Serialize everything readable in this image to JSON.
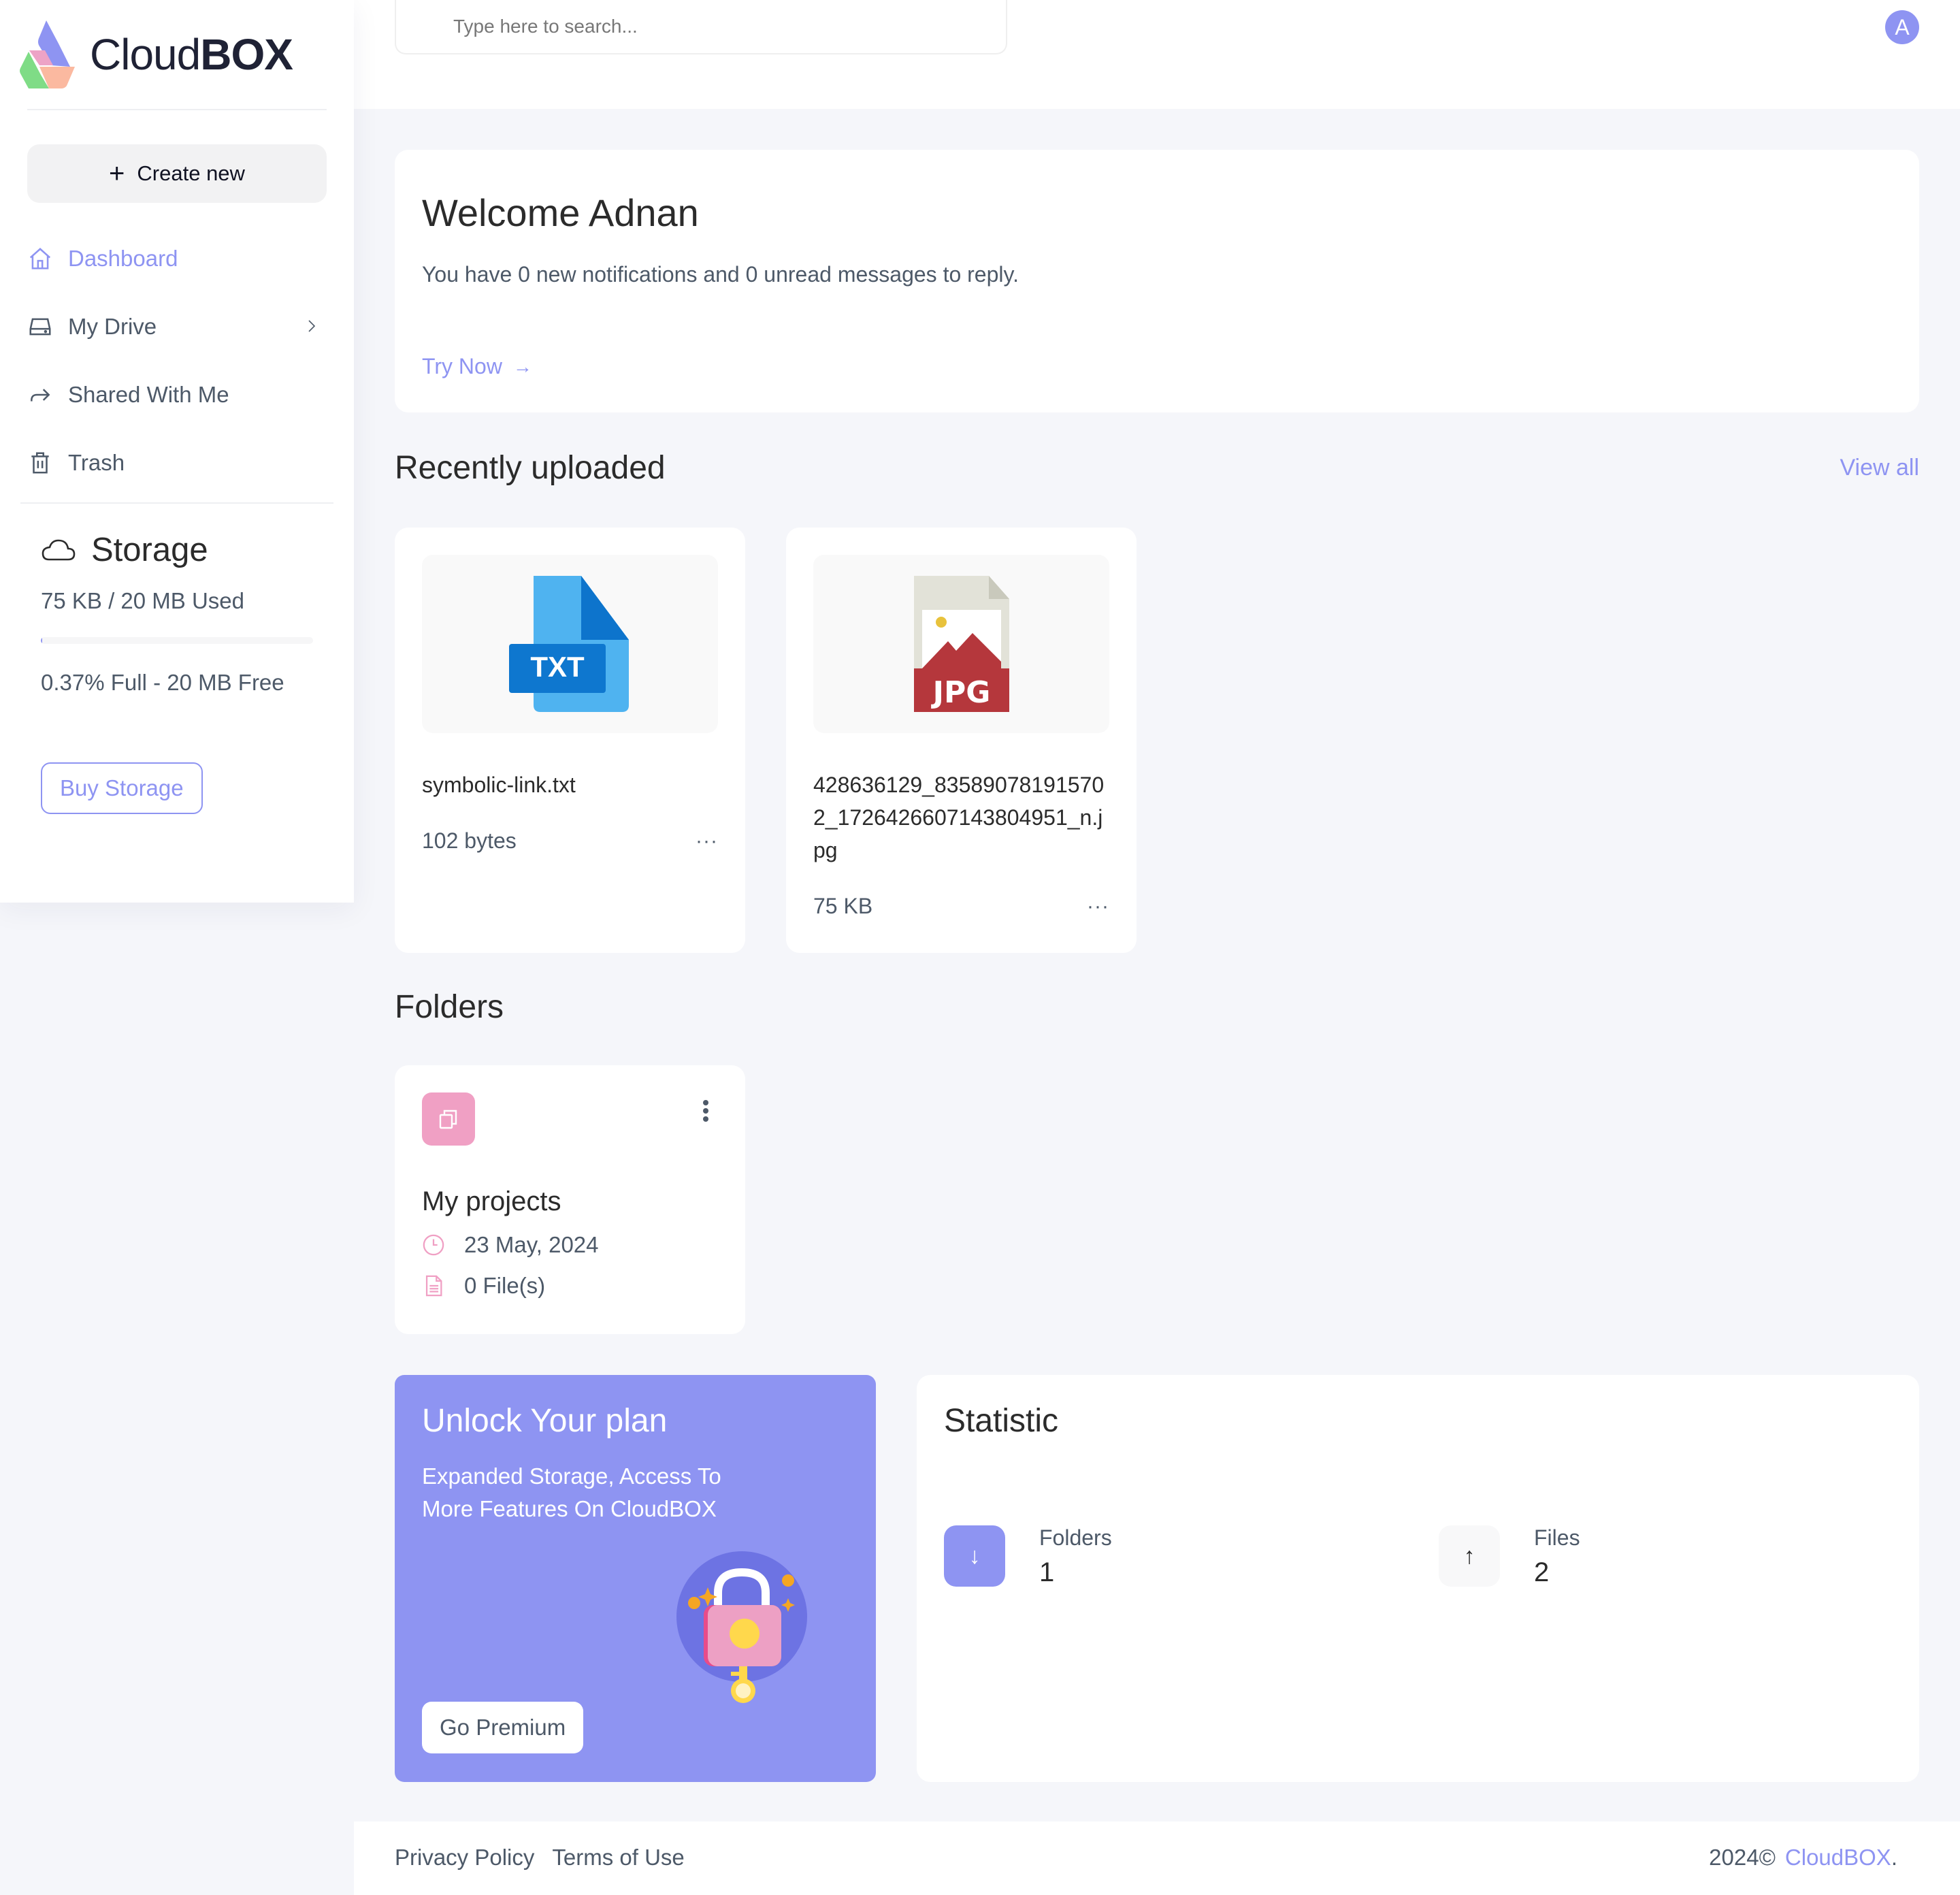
{
  "brand": {
    "name_light": "Cloud",
    "name_bold": "BOX",
    "accent_color": "#8e94f2"
  },
  "sidebar": {
    "create_new_label": "Create new",
    "items": [
      {
        "label": "Dashboard",
        "icon": "home-icon",
        "active": true
      },
      {
        "label": "My Drive",
        "icon": "drive-icon",
        "has_submenu": true
      },
      {
        "label": "Shared With Me",
        "icon": "share-icon"
      },
      {
        "label": "Trash",
        "icon": "trash-icon"
      }
    ],
    "storage": {
      "title": "Storage",
      "used_text": "75 KB / 20 MB Used",
      "percent_used": 0.37,
      "free_text": "0.37% Full - 20 MB Free",
      "buy_label": "Buy Storage"
    }
  },
  "header": {
    "search_placeholder": "Type here to search...",
    "avatar_initial": "A"
  },
  "welcome": {
    "title": "Welcome Adnan",
    "message": "You have 0 new notifications and 0 unread messages to reply.",
    "cta_label": "Try Now"
  },
  "recent": {
    "title": "Recently uploaded",
    "view_all_label": "View all",
    "files": [
      {
        "name": "symbolic-link.txt",
        "size": "102 bytes",
        "type": "TXT"
      },
      {
        "name": "428636129_835890781915702_1726426607143804951_n.jpg",
        "size": "75 KB",
        "type": "JPG"
      }
    ]
  },
  "folders": {
    "title": "Folders",
    "items": [
      {
        "name": "My projects",
        "date": "23 May, 2024",
        "files": "0 File(s)"
      }
    ]
  },
  "promo": {
    "title": "Unlock Your plan",
    "description": "Expanded Storage, Access To More Features On CloudBOX",
    "button_label": "Go Premium"
  },
  "statistic": {
    "title": "Statistic",
    "items": [
      {
        "label": "Folders",
        "value": "1",
        "icon": "arrow-down-icon"
      },
      {
        "label": "Files",
        "value": "2",
        "icon": "arrow-up-icon"
      }
    ]
  },
  "footer": {
    "links": [
      "Privacy Policy",
      "Terms of Use"
    ],
    "copyright": "2024©",
    "brand_link": "CloudBOX",
    "suffix": "."
  }
}
